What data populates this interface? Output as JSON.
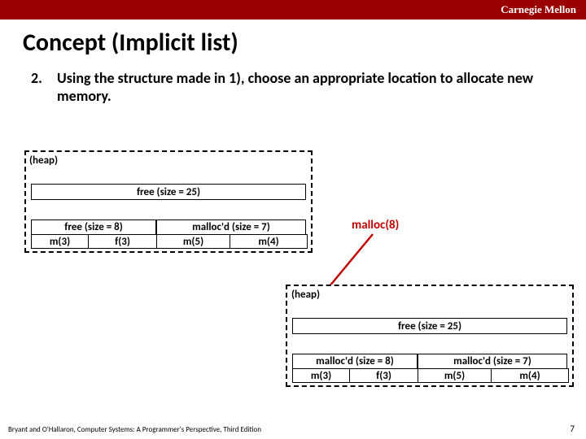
{
  "header": {
    "org": "Carnegie Mellon"
  },
  "title": "Concept (Implicit list)",
  "bullet": {
    "num": "2.",
    "text": "Using the structure made in 1), choose an appropriate location to allocate new memory."
  },
  "heap_label": "(heap)",
  "free25": "free (size = 25)",
  "before": {
    "free8": "free (size = 8)",
    "malloc7": "malloc'd (size = 7)",
    "cells": [
      "m(3)",
      "f(3)",
      "m(5)",
      "m(4)"
    ]
  },
  "call": "malloc(8)",
  "after": {
    "free25": "free (size = 25)",
    "malloc8": "malloc'd (size = 8)",
    "malloc7": "malloc'd (size = 7)",
    "cells": [
      "m(3)",
      "f(3)",
      "m(5)",
      "m(4)"
    ]
  },
  "footer": "Bryant and O'Hallaron, Computer Systems: A Programmer's Perspective, Third Edition",
  "page": "7"
}
